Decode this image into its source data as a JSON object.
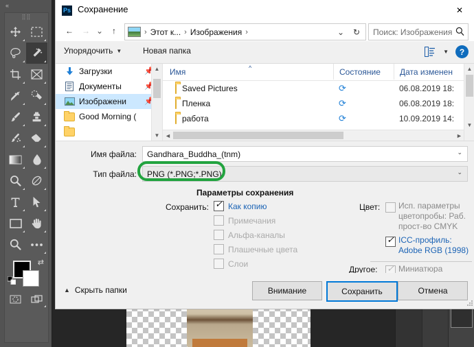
{
  "app": {
    "toolbar": {
      "collapse_label": "«",
      "tools": [
        {
          "name": "move-tool",
          "icon": "move"
        },
        {
          "name": "rectangular-marquee-tool",
          "icon": "marquee"
        },
        {
          "name": "lasso-tool",
          "icon": "lasso"
        },
        {
          "name": "magic-wand-tool",
          "icon": "wand"
        },
        {
          "name": "crop-tool",
          "icon": "crop"
        },
        {
          "name": "frame-tool",
          "icon": "frame"
        },
        {
          "name": "eyedropper-tool",
          "icon": "eyedropper"
        },
        {
          "name": "spot-healing-brush-tool",
          "icon": "healing"
        },
        {
          "name": "brush-tool",
          "icon": "brush"
        },
        {
          "name": "clone-stamp-tool",
          "icon": "stamp"
        },
        {
          "name": "history-brush-tool",
          "icon": "history-brush"
        },
        {
          "name": "eraser-tool",
          "icon": "eraser"
        },
        {
          "name": "gradient-tool",
          "icon": "gradient"
        },
        {
          "name": "blur-tool",
          "icon": "blur"
        },
        {
          "name": "dodge-tool",
          "icon": "dodge"
        },
        {
          "name": "pen-tool",
          "icon": "pen"
        },
        {
          "name": "type-tool",
          "icon": "type"
        },
        {
          "name": "path-selection-tool",
          "icon": "path-select"
        },
        {
          "name": "rectangle-tool",
          "icon": "rectangle"
        },
        {
          "name": "hand-tool",
          "icon": "hand"
        },
        {
          "name": "zoom-tool",
          "icon": "zoom"
        },
        {
          "name": "edit-toolbar-tool",
          "icon": "ellipsis"
        }
      ],
      "foreground_color": "#000000",
      "background_color": "#ffffff"
    }
  },
  "dialog": {
    "title": "Сохранение",
    "app_badge": "Ps",
    "close_label": "✕",
    "nav": {
      "back": "←",
      "forward": "→",
      "recent": "⌄",
      "up": "↑",
      "breadcrumb": [
        {
          "label": "Этот к..."
        },
        {
          "label": "Изображения"
        }
      ],
      "dropdown": "⌄",
      "refresh": "↻",
      "search_placeholder": "Поиск: Изображения",
      "search_icon": "search-icon"
    },
    "commandbar": {
      "organize": "Упорядочить",
      "new_folder": "Новая папка",
      "view_icon": "view-layout-icon",
      "help_label": "?"
    },
    "places": [
      {
        "label": "Загрузки",
        "icon": "download-arrow-icon",
        "selected": false,
        "pinned": true
      },
      {
        "label": "Документы",
        "icon": "document-icon",
        "selected": false,
        "pinned": true
      },
      {
        "label": "Изображени",
        "icon": "picture-icon",
        "selected": true,
        "pinned": true
      },
      {
        "label": "Good Morning (",
        "icon": "folder-icon",
        "selected": false,
        "pinned": false
      },
      {
        "label": "",
        "icon": "folder-icon",
        "selected": false,
        "pinned": false
      }
    ],
    "files": {
      "columns": [
        "Имя",
        "Состояние",
        "Дата изменен"
      ],
      "rows": [
        {
          "name": "Saved Pictures",
          "state": "sync-icon",
          "date": "06.08.2019 18:"
        },
        {
          "name": "Пленка",
          "state": "sync-icon",
          "date": "06.08.2019 18:"
        },
        {
          "name": "работа",
          "state": "sync-icon",
          "date": "10.09.2019 14:"
        }
      ]
    },
    "fields": {
      "file_name_label": "Имя файла:",
      "file_name_value": "Gandhara_Buddha_(tnm)",
      "file_type_label": "Тип файла:",
      "file_type_value": "PNG (*.PNG;*.PNG)",
      "highlight_color": "#22a33f"
    },
    "options": {
      "title": "Параметры сохранения",
      "save_label": "Сохранить:",
      "checkboxes": [
        {
          "label": "Как копию",
          "checked": true,
          "enabled": true
        },
        {
          "label": "Примечания",
          "checked": false,
          "enabled": false
        },
        {
          "label": "Альфа-каналы",
          "checked": false,
          "enabled": false
        },
        {
          "label": "Плашечные цвета",
          "checked": false,
          "enabled": false
        },
        {
          "label": "Слои",
          "checked": false,
          "enabled": false
        }
      ],
      "color_label": "Цвет:",
      "color_proof": {
        "label": "Исп. параметры цветопробы:  Раб. прост-во CMYK",
        "checked": false,
        "enabled": false
      },
      "icc_profile": {
        "label": "ICC-профиль:  Adobe RGB (1998)",
        "checked": true,
        "enabled": true
      },
      "other_label": "Другое:",
      "thumbnail": {
        "label": "Миниатюра",
        "checked": true,
        "enabled": false
      }
    },
    "footer": {
      "hide_folders": "Скрыть папки",
      "attention_button": "Внимание",
      "save_button": "Сохранить",
      "cancel_button": "Отмена"
    }
  }
}
